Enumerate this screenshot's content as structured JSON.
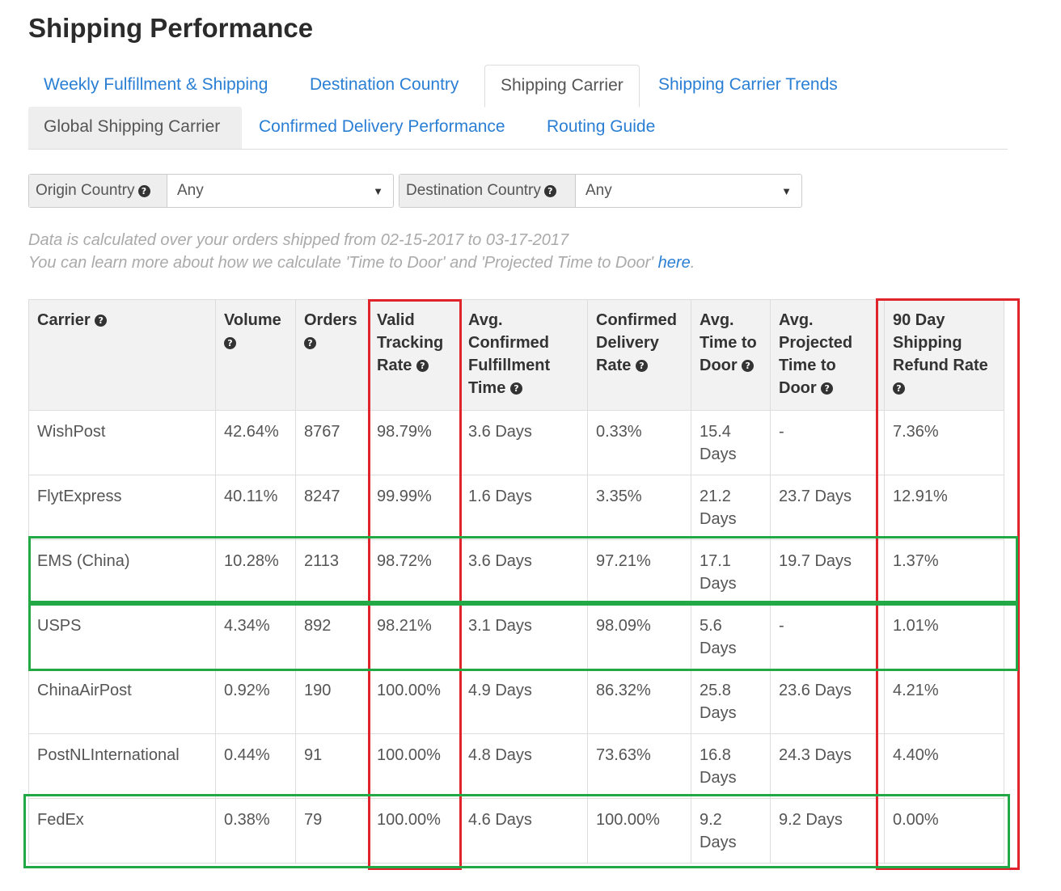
{
  "page": {
    "title": "Shipping Performance"
  },
  "tabs_primary": [
    {
      "label": "Weekly Fulfillment & Shipping",
      "active": false
    },
    {
      "label": "Destination Country",
      "active": false
    },
    {
      "label": "Shipping Carrier",
      "active": true
    },
    {
      "label": "Shipping Carrier Trends",
      "active": false
    }
  ],
  "tabs_secondary": [
    {
      "label": "Global Shipping Carrier",
      "active": true
    },
    {
      "label": "Confirmed Delivery Performance",
      "active": false
    },
    {
      "label": "Routing Guide",
      "active": false
    }
  ],
  "filters": {
    "origin": {
      "label": "Origin Country",
      "value": "Any"
    },
    "destination": {
      "label": "Destination Country",
      "value": "Any"
    }
  },
  "info": {
    "line1": "Data is calculated over your orders shipped from 02-15-2017 to 03-17-2017",
    "line2_prefix": "You can learn more about how we calculate 'Time to Door' and 'Projected Time to Door' ",
    "link": "here",
    "line2_suffix": "."
  },
  "icons": {
    "help": "question-circle-icon",
    "dropdown": "caret-down-icon"
  },
  "colors": {
    "link": "#2a7fd4",
    "highlight_red": "#e0242c",
    "highlight_green": "#22a845"
  },
  "table": {
    "columns": [
      {
        "label": "Carrier",
        "help": true
      },
      {
        "label": "Volume",
        "help": true
      },
      {
        "label": "Orders",
        "help": true
      },
      {
        "label": "Valid Tracking Rate",
        "help": true
      },
      {
        "label": "Avg. Confirmed Fulfillment Time",
        "help": true
      },
      {
        "label": "Confirmed Delivery Rate",
        "help": true
      },
      {
        "label": "Avg. Time to Door",
        "help": true
      },
      {
        "label": "Avg. Projected Time to Door",
        "help": true
      },
      {
        "label": "90 Day Shipping Refund Rate",
        "help": true
      }
    ],
    "rows": [
      [
        "WishPost",
        "42.64%",
        "8767",
        "98.79%",
        "3.6 Days",
        "0.33%",
        "15.4 Days",
        "-",
        "7.36%"
      ],
      [
        "FlytExpress",
        "40.11%",
        "8247",
        "99.99%",
        "1.6 Days",
        "3.35%",
        "21.2 Days",
        "23.7 Days",
        "12.91%"
      ],
      [
        "EMS (China)",
        "10.28%",
        "2113",
        "98.72%",
        "3.6 Days",
        "97.21%",
        "17.1 Days",
        "19.7 Days",
        "1.37%"
      ],
      [
        "USPS",
        "4.34%",
        "892",
        "98.21%",
        "3.1 Days",
        "98.09%",
        "5.6 Days",
        "-",
        "1.01%"
      ],
      [
        "ChinaAirPost",
        "0.92%",
        "190",
        "100.00%",
        "4.9 Days",
        "86.32%",
        "25.8 Days",
        "23.6 Days",
        "4.21%"
      ],
      [
        "PostNLInternational",
        "0.44%",
        "91",
        "100.00%",
        "4.8 Days",
        "73.63%",
        "16.8 Days",
        "24.3 Days",
        "4.40%"
      ],
      [
        "FedEx",
        "0.38%",
        "79",
        "100.00%",
        "4.6 Days",
        "100.00%",
        "9.2 Days",
        "9.2 Days",
        "0.00%"
      ]
    ]
  }
}
